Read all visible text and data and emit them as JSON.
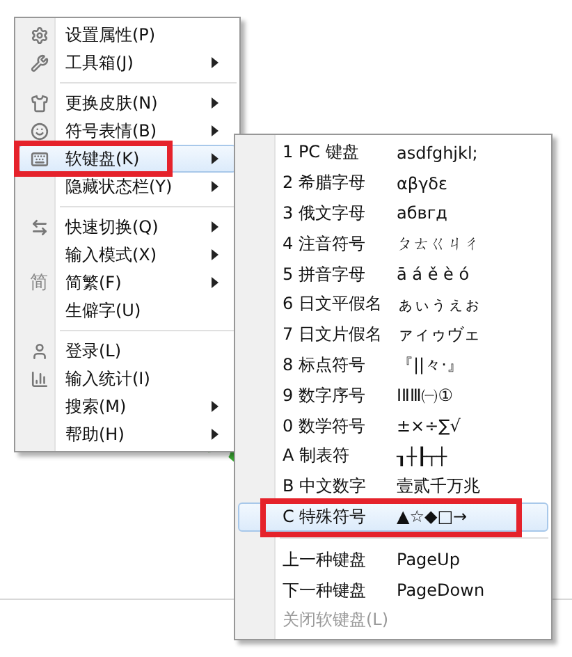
{
  "menu": {
    "items": [
      {
        "kind": "item",
        "label": "设置属性(P)",
        "submenu": false,
        "selected": false
      },
      {
        "kind": "item",
        "label": "工具箱(J)",
        "submenu": true,
        "selected": false
      },
      {
        "kind": "separator"
      },
      {
        "kind": "item",
        "label": "更换皮肤(N)",
        "submenu": true,
        "selected": false
      },
      {
        "kind": "item",
        "label": "符号表情(B)",
        "submenu": true,
        "selected": false
      },
      {
        "kind": "item",
        "label": "软键盘(K)",
        "submenu": true,
        "selected": true,
        "annotated": true
      },
      {
        "kind": "item",
        "label": "隐藏状态栏(Y)",
        "submenu": true,
        "selected": false
      },
      {
        "kind": "separator"
      },
      {
        "kind": "item",
        "label": "快速切换(Q)",
        "submenu": true,
        "selected": false
      },
      {
        "kind": "item",
        "label": "输入模式(X)",
        "submenu": true,
        "selected": false
      },
      {
        "kind": "item",
        "label": "简繁(F)",
        "submenu": true,
        "selected": false,
        "icon_text": "简"
      },
      {
        "kind": "item",
        "label": "生僻字(U)",
        "submenu": false,
        "selected": false
      },
      {
        "kind": "separator"
      },
      {
        "kind": "item",
        "label": "登录(L)",
        "submenu": false,
        "selected": false
      },
      {
        "kind": "item",
        "label": "输入统计(I)",
        "submenu": false,
        "selected": false
      },
      {
        "kind": "item",
        "label": "搜索(M)",
        "submenu": true,
        "selected": false
      },
      {
        "kind": "item",
        "label": "帮助(H)",
        "submenu": true,
        "selected": false
      }
    ]
  },
  "submenu": {
    "items": [
      {
        "kind": "item",
        "label": "1 PC 键盘",
        "sample": "asdfghjkl;",
        "selected": false,
        "disabled": false
      },
      {
        "kind": "item",
        "label": "2 希腊字母",
        "sample": "αβγδε",
        "selected": false,
        "disabled": false
      },
      {
        "kind": "item",
        "label": "3 俄文字母",
        "sample": "абвгд",
        "selected": false,
        "disabled": false
      },
      {
        "kind": "item",
        "label": "4 注音符号",
        "sample": "ㄆㄊㄍㄐㄔ",
        "selected": false,
        "disabled": false
      },
      {
        "kind": "item",
        "label": "5 拼音字母",
        "sample": "ā á ě è ó",
        "selected": false,
        "disabled": false
      },
      {
        "kind": "item",
        "label": "6 日文平假名",
        "sample": "ぁぃぅぇぉ",
        "selected": false,
        "disabled": false
      },
      {
        "kind": "item",
        "label": "7 日文片假名",
        "sample": "ァィゥヴェ",
        "selected": false,
        "disabled": false
      },
      {
        "kind": "item",
        "label": "8 标点符号",
        "sample": "『||々·』",
        "selected": false,
        "disabled": false
      },
      {
        "kind": "item",
        "label": "9 数字序号",
        "sample": "ⅠⅡⅢ㈠①",
        "selected": false,
        "disabled": false
      },
      {
        "kind": "item",
        "label": "0 数学符号",
        "sample": "±×÷∑√",
        "selected": false,
        "disabled": false
      },
      {
        "kind": "item",
        "label": "A 制表符",
        "sample": "┒┼┠┬┼",
        "selected": false,
        "disabled": false
      },
      {
        "kind": "item",
        "label": "B 中文数字",
        "sample": "壹贰千万兆",
        "selected": false,
        "disabled": false
      },
      {
        "kind": "item",
        "label": "C 特殊符号",
        "sample": "▲☆◆□→",
        "selected": true,
        "disabled": false,
        "annotated": true
      },
      {
        "kind": "separator"
      },
      {
        "kind": "item",
        "label": "上一种键盘",
        "sample": "PageUp",
        "selected": false,
        "disabled": false
      },
      {
        "kind": "item",
        "label": "下一种键盘",
        "sample": "PageDown",
        "selected": false,
        "disabled": false
      },
      {
        "kind": "item",
        "label": "关闭软键盘(L)",
        "selected": false,
        "disabled": true
      }
    ]
  }
}
